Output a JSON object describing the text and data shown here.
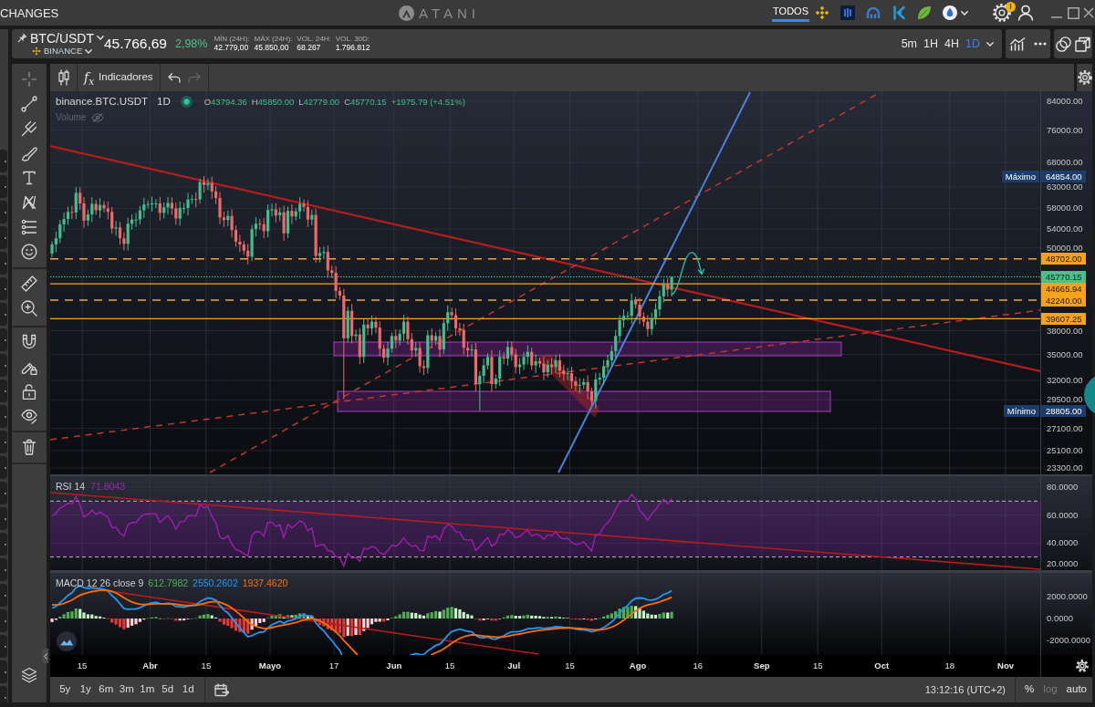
{
  "title_bar": {
    "section": "CHANGES",
    "logo": "ATANI",
    "filter_tabs": [
      {
        "label": "TODOS",
        "selected": true
      }
    ],
    "notification_badge": "!"
  },
  "ticker": {
    "pair": "BTC/USDT",
    "exchange": "BINANCE",
    "last_price": "45.766,69",
    "change": "2,98%",
    "stats": [
      {
        "label": "MÍN (24H):",
        "value": "42.779,00"
      },
      {
        "label": "MÁX (24H):",
        "value": "45.850,00"
      },
      {
        "label": "VOL. 24H:",
        "value": "68.267"
      },
      {
        "label": "VOL. 30D:",
        "value": "1.796.812"
      }
    ],
    "timeframes": [
      {
        "label": "5m",
        "selected": false
      },
      {
        "label": "1H",
        "selected": false
      },
      {
        "label": "4H",
        "selected": false
      },
      {
        "label": "1D",
        "selected": true
      }
    ]
  },
  "chart_toolbar": {
    "function_symbol": "f$_{x}$",
    "indicators": "Indicadores",
    "undo": {
      "disabled": false
    },
    "redo": {
      "disabled": true
    }
  },
  "legend": {
    "symbol": "binance.BTC.USDT",
    "interval": "1D",
    "ohlc": [
      {
        "key": "O",
        "value": "43794.36"
      },
      {
        "key": "H",
        "value": "45850.00"
      },
      {
        "key": "L",
        "value": "42779.00"
      },
      {
        "key": "C",
        "value": "45770.15"
      }
    ],
    "change": "+1975.79 (+4.51%)",
    "volume": "Volume"
  },
  "price_axis": {
    "ticks": [
      "84000.00",
      "76000.00",
      "68000.00",
      "63000.00",
      "58000.00",
      "54000.00",
      "50000.00",
      "38000.00",
      "35000.00",
      "32000.00",
      "29500.00",
      "27100.00",
      "25100.00",
      "23300.00"
    ],
    "tags": [
      {
        "kind": "extreme",
        "label": "Máximo",
        "value": "64854.00"
      },
      {
        "kind": "dashed_level",
        "value": "48702.00"
      },
      {
        "kind": "last_price",
        "value": "45770.15"
      },
      {
        "kind": "solid_level",
        "value": "44665.94"
      },
      {
        "kind": "dashed_level",
        "value": "42240.00"
      },
      {
        "kind": "solid_level",
        "value": "39607.25"
      },
      {
        "kind": "extreme",
        "label": "Mínimo",
        "value": "28805.00"
      }
    ]
  },
  "rsi": {
    "label": "RSI 14",
    "value": "71.8043",
    "ticks": [
      "80.0000",
      "60.0000",
      "40.0000",
      "20.0000"
    ]
  },
  "macd": {
    "label": "MACD 12 26 close 9",
    "values": [
      {
        "value": "612.7982",
        "color": "#4caf50"
      },
      {
        "value": "2550.2602",
        "color": "#2196f3"
      },
      {
        "value": "1937.4620",
        "color": "#ff6d00"
      }
    ],
    "ticks": [
      "2000.0000",
      "0.0000",
      "-2000.0000"
    ]
  },
  "time_axis": {
    "labels": [
      {
        "text": "15",
        "kind": "day"
      },
      {
        "text": "Abr",
        "kind": "month"
      },
      {
        "text": "15",
        "kind": "day"
      },
      {
        "text": "Mayo",
        "kind": "month"
      },
      {
        "text": "17",
        "kind": "day"
      },
      {
        "text": "Jun",
        "kind": "month"
      },
      {
        "text": "15",
        "kind": "day"
      },
      {
        "text": "Jul",
        "kind": "month"
      },
      {
        "text": "15",
        "kind": "day"
      },
      {
        "text": "Ago",
        "kind": "month"
      },
      {
        "text": "16",
        "kind": "day"
      },
      {
        "text": "Sep",
        "kind": "month"
      },
      {
        "text": "15",
        "kind": "day"
      },
      {
        "text": "Oct",
        "kind": "month"
      },
      {
        "text": "18",
        "kind": "day"
      },
      {
        "text": "Nov",
        "kind": "month"
      }
    ]
  },
  "bottom_bar": {
    "ranges": [
      "5y",
      "1y",
      "6m",
      "3m",
      "1m",
      "5d",
      "1d"
    ],
    "clock": "13:12:16 (UTC+2)",
    "scale_options": [
      {
        "label": "%",
        "on": true
      },
      {
        "label": "log",
        "on": false
      },
      {
        "label": "auto",
        "on": true
      }
    ]
  }
}
